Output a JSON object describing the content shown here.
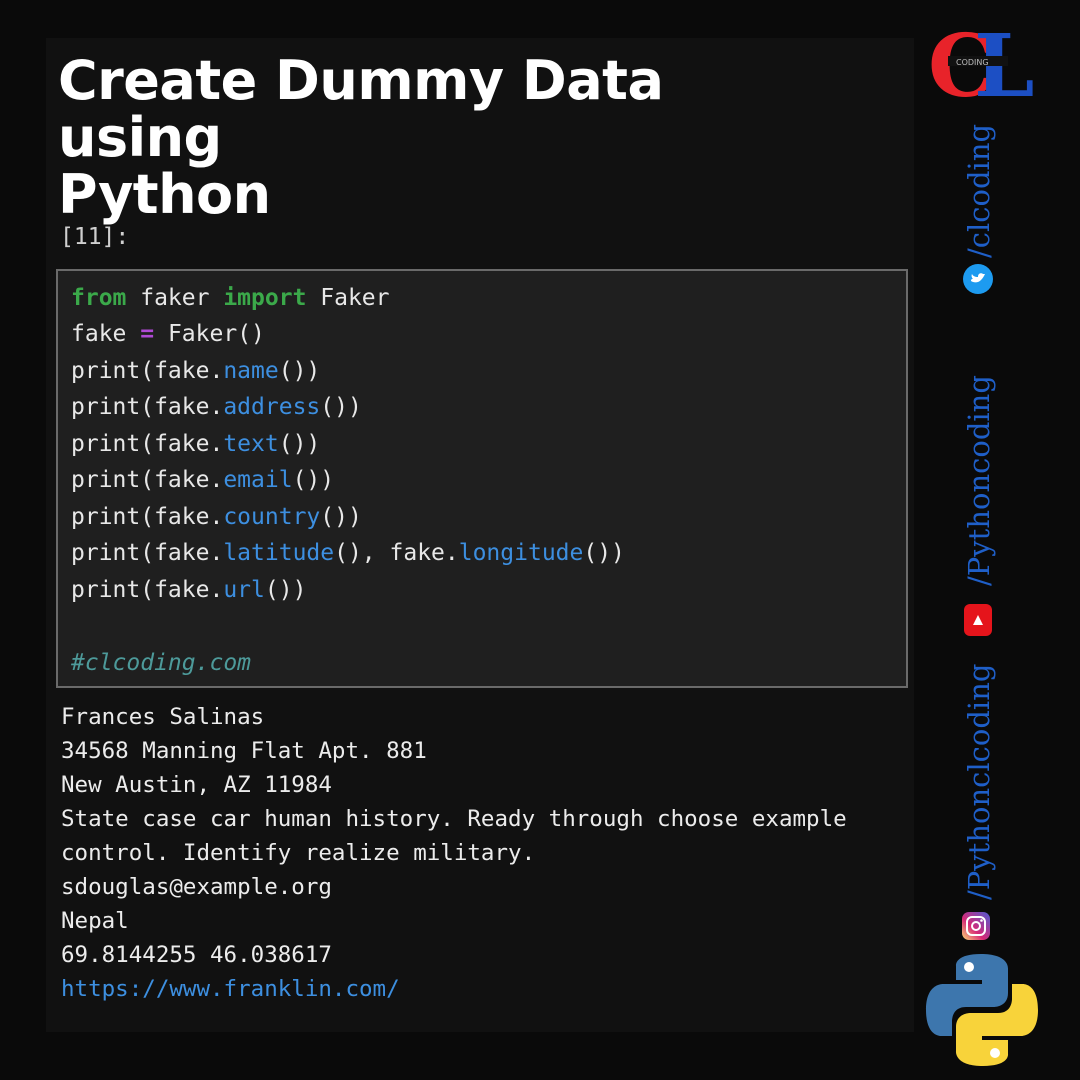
{
  "header": {
    "title_line1": "Create Dummy Data using",
    "title_line2": "Python"
  },
  "cell": {
    "prompt": "[11]:"
  },
  "code": {
    "line1": {
      "kw1": "from",
      "mod": " faker ",
      "kw2": "import",
      "cls": " Faker"
    },
    "line2": {
      "var": "fake ",
      "op": "=",
      "call": " Faker()"
    },
    "line3": {
      "pre": "print(fake.",
      "fn": "name",
      "post": "())"
    },
    "line4": {
      "pre": "print(fake.",
      "fn": "address",
      "post": "())"
    },
    "line5": {
      "pre": "print(fake.",
      "fn": "text",
      "post": "())"
    },
    "line6": {
      "pre": "print(fake.",
      "fn": "email",
      "post": "())"
    },
    "line7": {
      "pre": "print(fake.",
      "fn": "country",
      "post": "())"
    },
    "line8": {
      "pre": "print(fake.",
      "fn": "latitude",
      "mid": "(), fake.",
      "fn2": "longitude",
      "post": "())"
    },
    "line9": {
      "pre": "print(fake.",
      "fn": "url",
      "post": "())"
    },
    "comment": "#clcoding.com"
  },
  "output": {
    "lines": [
      "Frances Salinas",
      "34568 Manning Flat Apt. 881",
      "New Austin, AZ 11984",
      "State case car human history. Ready through choose example",
      "control. Identify realize military.",
      "sdouglas@example.org",
      "Nepal",
      "69.8144255 46.038617"
    ],
    "link": "https://www.franklin.com/"
  },
  "sidebar": {
    "logo_text": "CL",
    "logo_band": "CODING",
    "twitter_handle": "/clcoding",
    "youtube_handle": "/Pythoncoding",
    "instagram_handle": "/Pythonclcoding"
  },
  "colors": {
    "keyword": "#3ba94a",
    "operator": "#b04ad6",
    "method": "#3d8fe0",
    "comment": "#4d9a9a",
    "handles": "#1f5fc8"
  }
}
